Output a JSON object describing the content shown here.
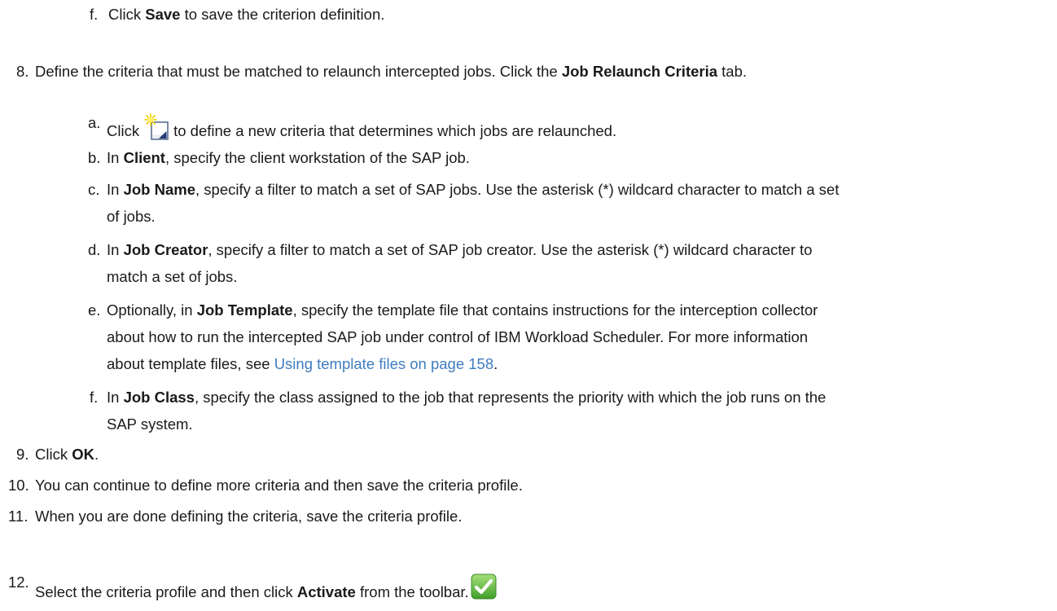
{
  "step7f": {
    "num": "f.",
    "pre": "Click ",
    "bold": "Save",
    "post": " to save the criterion definition."
  },
  "step8": {
    "num": "8.",
    "pre": "Define the criteria that must be matched to relaunch intercepted jobs. Click the ",
    "bold": "Job Relaunch Criteria",
    "post": " tab."
  },
  "step8a": {
    "num": "a.",
    "pre": "Click",
    "post": "to define a new criteria that determines which jobs are relaunched."
  },
  "step8b": {
    "num": "b.",
    "pre": "In ",
    "bold": "Client",
    "post": ", specify the client workstation of the SAP job."
  },
  "step8c": {
    "num": "c.",
    "pre": "In ",
    "bold": "Job Name",
    "post": ", specify a filter to match a set of SAP jobs. Use the asterisk (*) wildcard character to match a set",
    "line2": "of jobs."
  },
  "step8d": {
    "num": "d.",
    "pre": "In ",
    "bold": "Job Creator",
    "post": ", specify a filter to match a set of SAP job creator. Use the asterisk (*) wildcard character to",
    "line2": "match a set of jobs."
  },
  "step8e": {
    "num": "e.",
    "pre": "Optionally, in ",
    "bold": "Job Template",
    "post": ", specify the template file that contains instructions for the interception collector",
    "line2": "about how to run the intercepted SAP job under control of IBM Workload Scheduler. For more information",
    "line3_pre": "about template files, see ",
    "link": "Using template files on page 158",
    "line3_post": "."
  },
  "step8f": {
    "num": "f.",
    "pre": "In ",
    "bold": "Job Class",
    "post": ", specify the class assigned to the job that represents the priority with which the job runs on the",
    "line2": "SAP system."
  },
  "step9": {
    "num": "9.",
    "pre": "Click ",
    "bold": "OK",
    "post": "."
  },
  "step10": {
    "num": "10.",
    "text": "You can continue to define more criteria and then save the criteria profile."
  },
  "step11": {
    "num": "11.",
    "text": "When you are done defining the criteria, save the criteria profile."
  },
  "step12": {
    "num": "12.",
    "pre": "Select the criteria profile and then click ",
    "bold": "Activate",
    "post": " from the toolbar."
  },
  "icons": {
    "new_criteria": "new-document-icon",
    "activate": "activate-check-icon"
  }
}
